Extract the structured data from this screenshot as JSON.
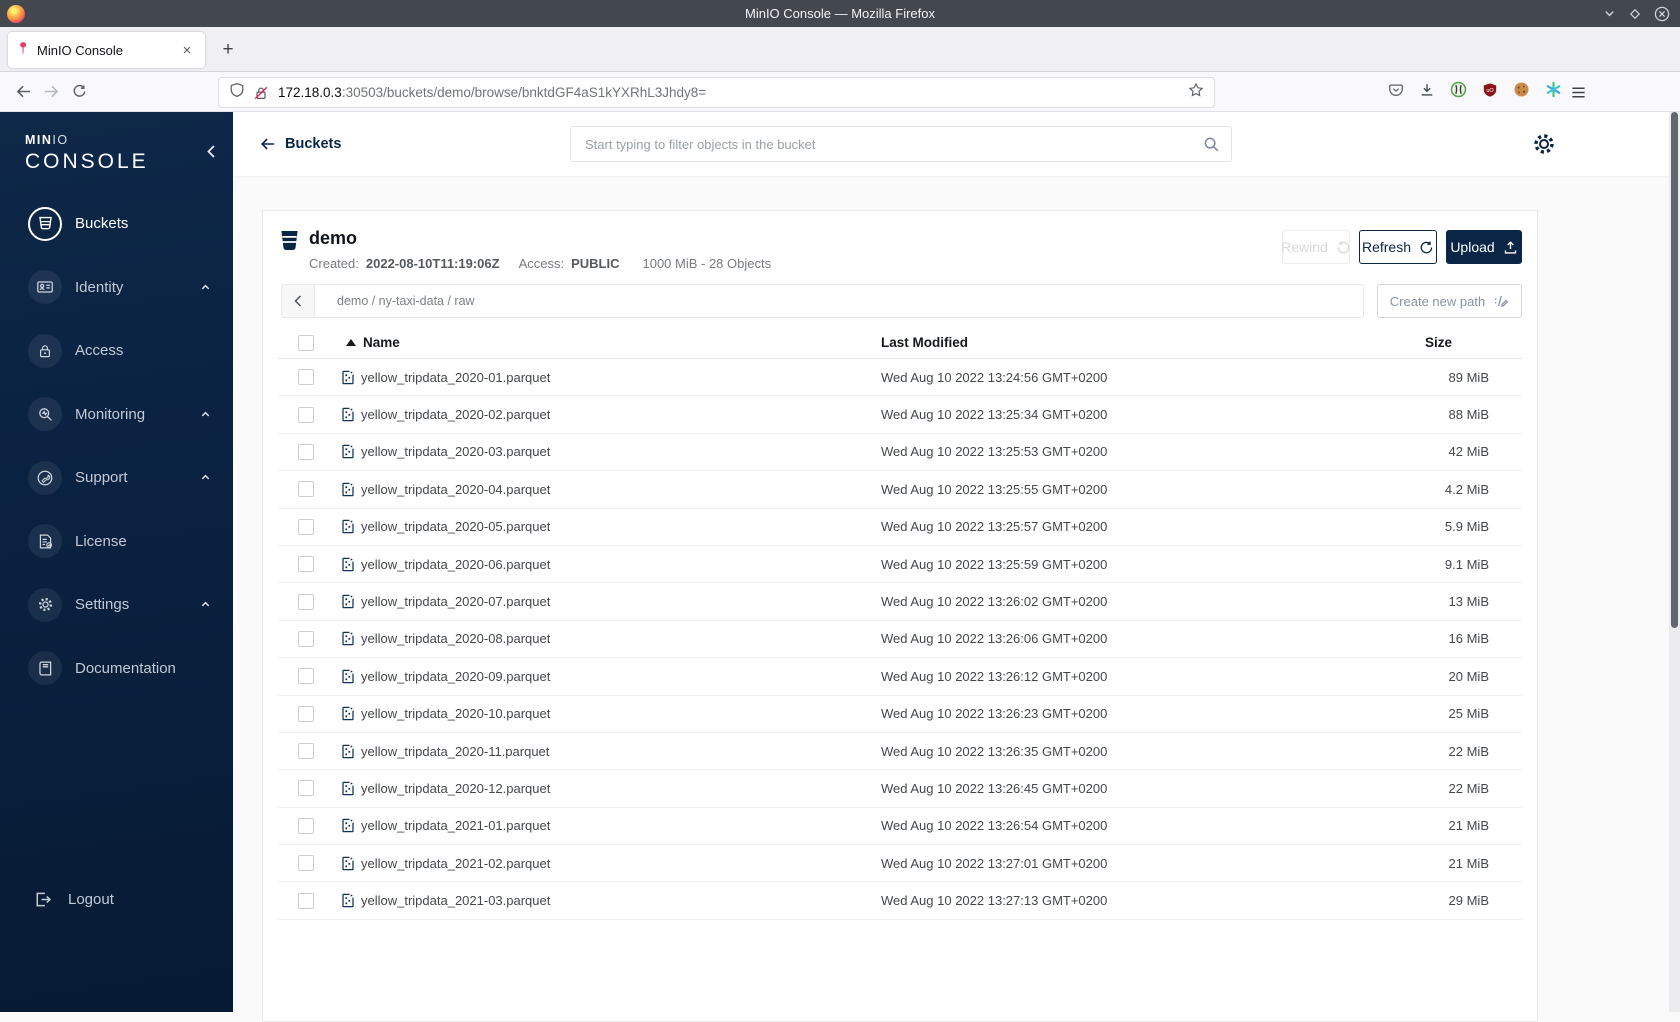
{
  "window": {
    "title": "MinIO Console — Mozilla Firefox"
  },
  "tabbar": {
    "tab_title": "MinIO Console",
    "close_label": "×",
    "new_tab_label": "+"
  },
  "urlbar": {
    "url_host": "172.18.0.3",
    "url_rest": ":30503/buckets/demo/browse/bnktdGF4aS1kYXRhL3Jhdy8="
  },
  "sidebar": {
    "logo_primary": "MIN",
    "logo_secondary": "IO",
    "logo_title": "CONSOLE",
    "items": [
      {
        "label": "Buckets",
        "icon": "bucket-icon",
        "active": true,
        "expandable": false
      },
      {
        "label": "Identity",
        "icon": "identity-icon",
        "active": false,
        "expandable": true
      },
      {
        "label": "Access",
        "icon": "access-icon",
        "active": false,
        "expandable": false
      },
      {
        "label": "Monitoring",
        "icon": "monitoring-icon",
        "active": false,
        "expandable": true
      },
      {
        "label": "Support",
        "icon": "support-icon",
        "active": false,
        "expandable": true
      },
      {
        "label": "License",
        "icon": "license-icon",
        "active": false,
        "expandable": false
      },
      {
        "label": "Settings",
        "icon": "settings-icon",
        "active": false,
        "expandable": true
      },
      {
        "label": "Documentation",
        "icon": "documentation-icon",
        "active": false,
        "expandable": false
      }
    ],
    "logout_label": "Logout"
  },
  "topbar": {
    "back_label": "Buckets",
    "search_placeholder": "Start typing to filter objects in the bucket"
  },
  "bucket": {
    "name": "demo",
    "created_label": "Created:",
    "created_value": "2022-08-10T11:19:06Z",
    "access_label": "Access:",
    "access_value": "PUBLIC",
    "usage_summary": "1000 MiB - 28 Objects",
    "rewind_label": "Rewind",
    "refresh_label": "Refresh",
    "upload_label": "Upload"
  },
  "path_nav": {
    "segments": [
      "demo",
      "ny-taxi-data",
      "raw"
    ],
    "separator": " / ",
    "create_path_label": "Create new path"
  },
  "table": {
    "columns": {
      "name": "Name",
      "modified": "Last Modified",
      "size": "Size"
    },
    "rows": [
      {
        "name": "yellow_tripdata_2020-01.parquet",
        "modified": "Wed Aug 10 2022 13:24:56 GMT+0200",
        "size": "89 MiB"
      },
      {
        "name": "yellow_tripdata_2020-02.parquet",
        "modified": "Wed Aug 10 2022 13:25:34 GMT+0200",
        "size": "88 MiB"
      },
      {
        "name": "yellow_tripdata_2020-03.parquet",
        "modified": "Wed Aug 10 2022 13:25:53 GMT+0200",
        "size": "42 MiB"
      },
      {
        "name": "yellow_tripdata_2020-04.parquet",
        "modified": "Wed Aug 10 2022 13:25:55 GMT+0200",
        "size": "4.2 MiB"
      },
      {
        "name": "yellow_tripdata_2020-05.parquet",
        "modified": "Wed Aug 10 2022 13:25:57 GMT+0200",
        "size": "5.9 MiB"
      },
      {
        "name": "yellow_tripdata_2020-06.parquet",
        "modified": "Wed Aug 10 2022 13:25:59 GMT+0200",
        "size": "9.1 MiB"
      },
      {
        "name": "yellow_tripdata_2020-07.parquet",
        "modified": "Wed Aug 10 2022 13:26:02 GMT+0200",
        "size": "13 MiB"
      },
      {
        "name": "yellow_tripdata_2020-08.parquet",
        "modified": "Wed Aug 10 2022 13:26:06 GMT+0200",
        "size": "16 MiB"
      },
      {
        "name": "yellow_tripdata_2020-09.parquet",
        "modified": "Wed Aug 10 2022 13:26:12 GMT+0200",
        "size": "20 MiB"
      },
      {
        "name": "yellow_tripdata_2020-10.parquet",
        "modified": "Wed Aug 10 2022 13:26:23 GMT+0200",
        "size": "25 MiB"
      },
      {
        "name": "yellow_tripdata_2020-11.parquet",
        "modified": "Wed Aug 10 2022 13:26:35 GMT+0200",
        "size": "22 MiB"
      },
      {
        "name": "yellow_tripdata_2020-12.parquet",
        "modified": "Wed Aug 10 2022 13:26:45 GMT+0200",
        "size": "22 MiB"
      },
      {
        "name": "yellow_tripdata_2021-01.parquet",
        "modified": "Wed Aug 10 2022 13:26:54 GMT+0200",
        "size": "21 MiB"
      },
      {
        "name": "yellow_tripdata_2021-02.parquet",
        "modified": "Wed Aug 10 2022 13:27:01 GMT+0200",
        "size": "21 MiB"
      },
      {
        "name": "yellow_tripdata_2021-03.parquet",
        "modified": "Wed Aug 10 2022 13:27:13 GMT+0200",
        "size": "29 MiB"
      }
    ]
  },
  "colors": {
    "accent_navy": "#0A2546",
    "sidebar_top": "#0E2849",
    "sidebar_bottom": "#071A33"
  }
}
